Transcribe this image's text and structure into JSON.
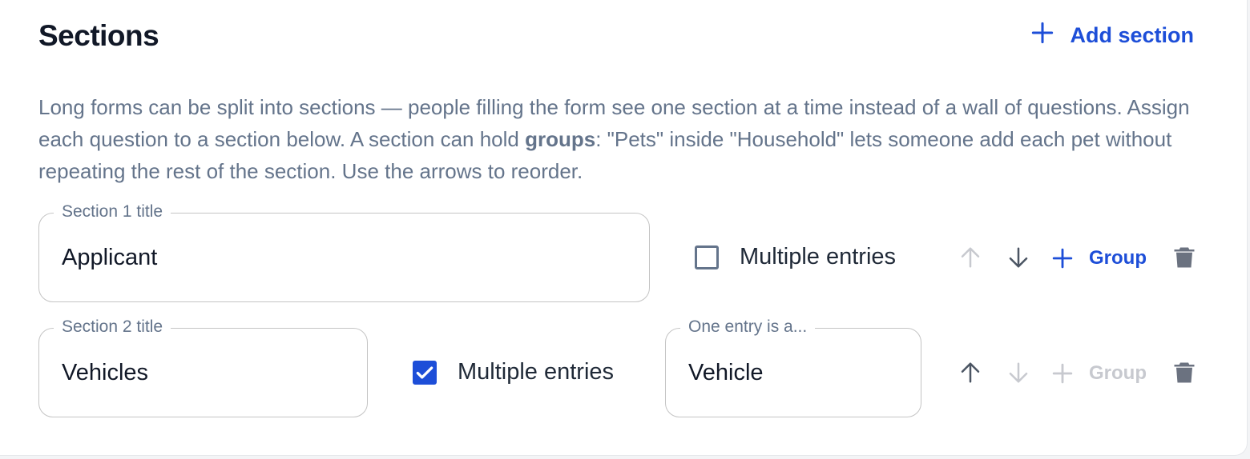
{
  "header": {
    "title": "Sections",
    "add_section_label": "Add section"
  },
  "description": {
    "part1": "Long forms can be split into sections — people filling the form see one section at a time instead of a wall of questions. Assign each question to a section below. A section can hold ",
    "bold": "groups",
    "part2": ": \"Pets\" inside \"Household\" lets someone add each pet without repeating the rest of the section. Use the arrows to reorder."
  },
  "sections": [
    {
      "legend": "Section 1 title",
      "value": "Applicant",
      "multiple_entries_label": "Multiple entries",
      "multiple_entries_checked": false,
      "group_label": "Group",
      "move_up_enabled": false,
      "move_down_enabled": true,
      "add_group_enabled": true
    },
    {
      "legend": "Section 2 title",
      "value": "Vehicles",
      "multiple_entries_label": "Multiple entries",
      "multiple_entries_checked": true,
      "entry_legend": "One entry is a...",
      "entry_value": "Vehicle",
      "group_label": "Group",
      "move_up_enabled": true,
      "move_down_enabled": false,
      "add_group_enabled": false
    }
  ],
  "icons": {
    "add": "plus-icon",
    "up": "arrow-up-icon",
    "down": "arrow-down-icon",
    "delete": "trash-icon",
    "check": "checkmark-icon"
  },
  "colors": {
    "accent": "#1d4ed8",
    "text": "#111827",
    "muted": "#64748b",
    "disabled": "#c7c9cf",
    "icon_enabled": "#4b5563",
    "trash": "#6b7280"
  }
}
